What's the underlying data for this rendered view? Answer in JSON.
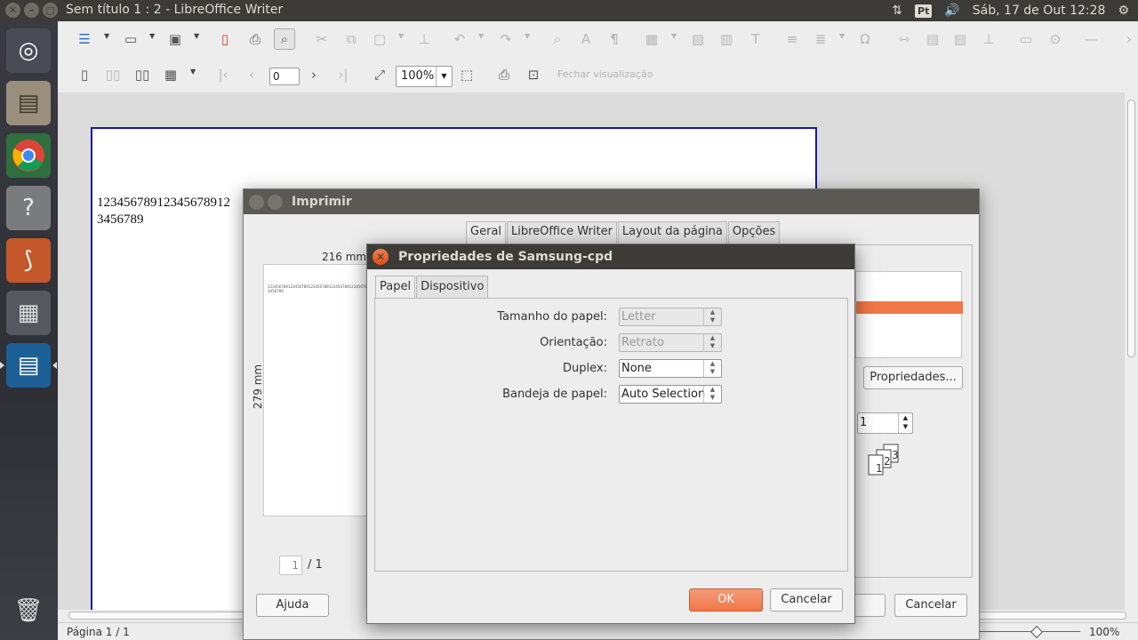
{
  "top_panel": {
    "window_title": "Sem título 1 : 2 - LibreOffice Writer",
    "keyboard_layout": "Pt",
    "datetime": "Sáb, 17 de Out 12:28"
  },
  "writer": {
    "page_number_value": "0",
    "zoom_value": "100%",
    "close_preview_label": "Fechar visualização",
    "document_text": "12345678912345678912\n3456789",
    "status_page": "Página 1 / 1",
    "status_zoom": "100%"
  },
  "print_dialog": {
    "title": "Imprimir",
    "tabs": [
      "Geral",
      "LibreOffice Writer",
      "Layout da página",
      "Opções"
    ],
    "width_label": "216 mm",
    "height_label": "279 mm",
    "preview_text": "12345678912345678912345678912345678912345678912345678912345678\n3456789",
    "page_current": "1",
    "page_total": "/ 1",
    "properties_button": "Propriedades...",
    "copies_value": "1",
    "help_button": "Ajuda",
    "cancel_button": "Cancelar"
  },
  "props_dialog": {
    "title": "Propriedades de Samsung-cpd",
    "tabs": [
      "Papel",
      "Dispositivo"
    ],
    "fields": [
      {
        "label": "Tamanho do papel:",
        "value": "Letter",
        "enabled": false
      },
      {
        "label": "Orientação:",
        "value": "Retrato",
        "enabled": false
      },
      {
        "label": "Duplex:",
        "value": "None",
        "enabled": true
      },
      {
        "label": "Bandeja de papel:",
        "value": "Auto Selection",
        "enabled": true
      }
    ],
    "ok_button": "OK",
    "cancel_button": "Cancelar"
  },
  "colors": {
    "accent": "#f07746",
    "panel": "#3c3b37"
  }
}
